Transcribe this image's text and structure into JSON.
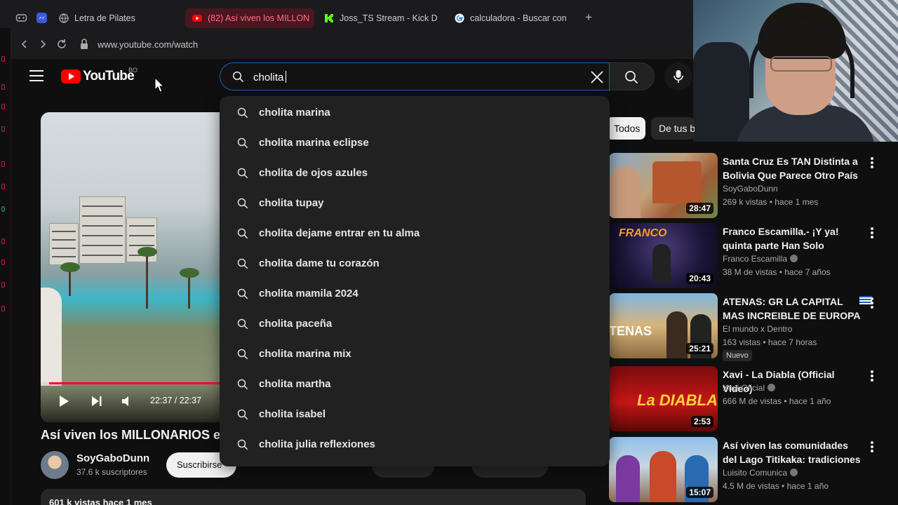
{
  "browser": {
    "tabs": [
      {
        "label": "Letra de Pilates",
        "active": false
      },
      {
        "label": "(82) Así viven los MILLON",
        "active": true
      },
      {
        "label": "Joss_TS Stream - Kick D",
        "active": false
      },
      {
        "label": "calculadora - Buscar con",
        "active": false
      }
    ],
    "new_tab_glyph": "+",
    "url": "www.youtube.com/watch"
  },
  "header": {
    "logo_text": "YouTube",
    "logo_country": "BO",
    "search_query": "cholita",
    "accent_color": "#ff0000",
    "focus_color": "#1c62b9"
  },
  "suggestions": [
    "cholita marina",
    "cholita marina eclipse",
    "cholita de ojos azules",
    "cholita tupay",
    "cholita dejame entrar en tu alma",
    "cholita dame tu corazón",
    "cholita mamila 2024",
    "cholita paceña",
    "cholita marina mix",
    "cholita martha",
    "cholita isabel",
    "cholita julia reflexiones"
  ],
  "player": {
    "timecode": "22:37 / 22:37",
    "progress": 1.0
  },
  "video": {
    "title": "Así viven los MILLONARIOS e",
    "channel": "SoyGaboDunn",
    "subscribers": "37.6 k suscriptores",
    "subscribe_label": "Suscribirse",
    "views_date": "601 k vistas  hace 1 mes"
  },
  "chips": {
    "active": "Todos",
    "other": "De tus b"
  },
  "recommendations": [
    {
      "title": "Santa Cruz Es TAN Distinta a Bolivia Que Parece Otro País",
      "channel": "SoyGaboDunn",
      "verified": false,
      "meta": "269 k vistas • hace 1 mes",
      "duration": "28:47",
      "badge": ""
    },
    {
      "title": "Franco Escamilla.- ¡Y ya! quinta parte Han Solo",
      "channel": "Franco Escamilla",
      "verified": true,
      "meta": "38 M de vistas • hace 7 años",
      "duration": "20:43",
      "badge": ""
    },
    {
      "title": "ATENAS: GR LA CAPITAL MAS INCREIBLE DE EUROPA😨",
      "channel": "El mundo x Dentro",
      "verified": false,
      "meta": "163 vistas • hace 7 horas",
      "duration": "25:21",
      "badge": "Nuevo"
    },
    {
      "title": "Xavi - La Diabla (Official Video)",
      "channel": "Xavi Oficial",
      "verified": true,
      "meta": "666 M de vistas • hace 1 año",
      "duration": "2:53",
      "badge": ""
    },
    {
      "title": "Así viven las comunidades del Lago Titikaka: tradiciones y ...",
      "channel": "Luisito Comunica",
      "verified": true,
      "meta": "4.5 M de vistas • hace 1 año",
      "duration": "15:07",
      "badge": ""
    }
  ]
}
